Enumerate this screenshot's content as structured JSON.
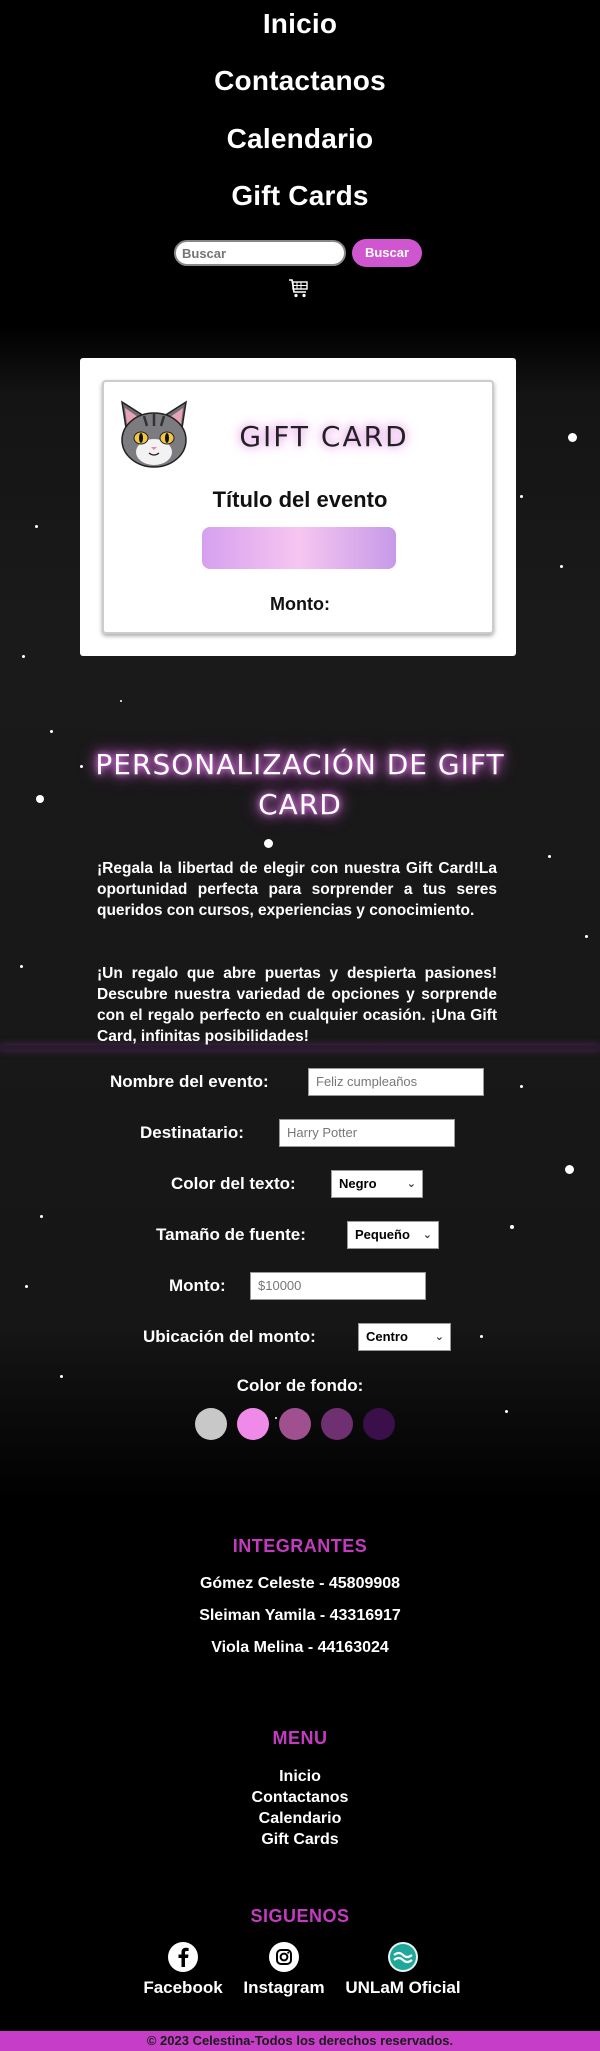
{
  "nav": {
    "items": [
      {
        "label": "Inicio"
      },
      {
        "label": "Contactanos"
      },
      {
        "label": "Calendario"
      },
      {
        "label": "Gift Cards"
      }
    ],
    "search_placeholder": "Buscar",
    "search_button": "Buscar",
    "cart_icon": "shopping-cart-icon"
  },
  "preview": {
    "avatar_icon": "cat-avatar-icon",
    "gift_title": "GIFT CARD",
    "event_title": "Título del evento",
    "amount_label": "Monto:"
  },
  "personalization": {
    "title": "PERSONALIZACIÓN DE GIFT CARD",
    "paragraph1": "¡Regala la libertad de elegir con nuestra Gift Card!La oportunidad perfecta para sorprender a tus seres queridos con cursos, experiencias y conocimiento.",
    "paragraph2": "¡Un regalo que abre puertas y despierta pasiones! Descubre nuestra variedad de opciones y sorprende con el regalo perfecto en cualquier ocasión. ¡Una Gift Card, infinitas posibilidades!",
    "fields": {
      "event_name": {
        "label": "Nombre del evento:",
        "placeholder": "Feliz cumpleaños"
      },
      "recipient": {
        "label": "Destinatario:",
        "placeholder": "Harry Potter"
      },
      "text_color": {
        "label": "Color del texto:",
        "value": "Negro"
      },
      "font_size": {
        "label": "Tamaño de fuente:",
        "value": "Pequeño"
      },
      "amount": {
        "label": "Monto:",
        "placeholder": "$10000"
      },
      "amount_position": {
        "label": "Ubicación del monto:",
        "value": "Centro"
      }
    },
    "background_label": "Color de fondo:",
    "background_colors": [
      "#c8c8c8",
      "#f08ae8",
      "#a0508e",
      "#6e3070",
      "#3a0f4a"
    ]
  },
  "footer": {
    "members_title": "INTEGRANTES",
    "members": [
      "Gómez Celeste - 45809908",
      "Sleiman Yamila - 43316917",
      "Viola Melina - 44163024"
    ],
    "menu_title": "MENU",
    "menu_items": [
      "Inicio",
      "Contactanos",
      "Calendario",
      "Gift Cards"
    ],
    "follow_title": "SIGUENOS",
    "socials": [
      {
        "label": "Facebook",
        "icon": "facebook-icon"
      },
      {
        "label": "Instagram",
        "icon": "instagram-icon"
      },
      {
        "label": "UNLaM Oficial",
        "icon": "unlam-icon"
      }
    ],
    "copyright": "© 2023 Celestina-Todos los derechos reservados."
  },
  "colors": {
    "accent": "#c43bc1",
    "search_button": "#d056cf",
    "copyright_bar": "#c63ec8"
  }
}
